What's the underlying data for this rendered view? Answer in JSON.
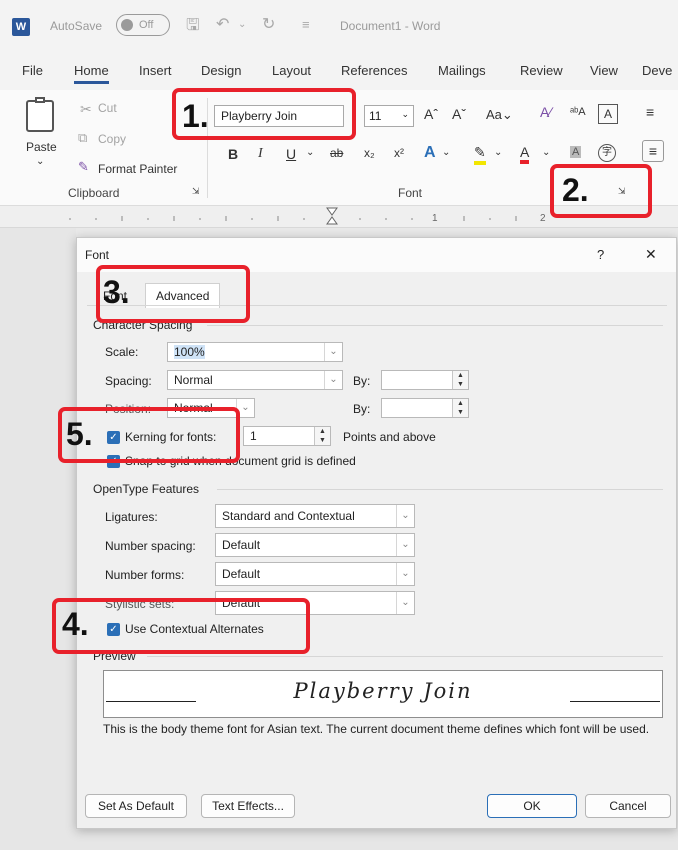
{
  "window": {
    "autosave_label": "AutoSave",
    "autosave_state": "Off",
    "doc_title": "Document1  -  Word"
  },
  "menu": [
    "File",
    "Home",
    "Insert",
    "Design",
    "Layout",
    "References",
    "Mailings",
    "Review",
    "View",
    "Deve"
  ],
  "ribbon": {
    "paste": "Paste",
    "cut": "Cut",
    "copy": "Copy",
    "format_painter": "Format Painter",
    "clipboard_group": "Clipboard",
    "font_name": "Playberry Join",
    "font_size": "11",
    "font_group": "Font"
  },
  "dialog": {
    "title": "Font",
    "help": "?",
    "close": "✕",
    "tabs": [
      "Font",
      "Advanced"
    ],
    "char_spacing_heading": "Character Spacing",
    "scale_label": "Scale:",
    "scale_value": "100%",
    "spacing_label": "Spacing:",
    "spacing_value": "Normal",
    "by1_label": "By:",
    "position_label": "Position:",
    "position_value": "Normal",
    "by2_label": "By:",
    "kerning_label": "Kerning for fonts:",
    "kerning_value": "1",
    "points_label": "Points and above",
    "snap_label": "Snap to grid when document grid is defined",
    "opentype_heading": "OpenType Features",
    "ligatures_label": "Ligatures:",
    "ligatures_value": "Standard and Contextual",
    "num_spacing_label": "Number spacing:",
    "num_spacing_value": "Default",
    "num_forms_label": "Number forms:",
    "num_forms_value": "Default",
    "stylistic_label": "Stylistic sets:",
    "stylistic_value": "Default",
    "contextual_label": "Use Contextual Alternates",
    "preview_heading": "Preview",
    "preview_text": "Playberry Join",
    "description": "This is the body theme font for Asian text. The current document theme defines which font will be used.",
    "btn_set_default": "Set As Default",
    "btn_text_effects": "Text Effects...",
    "btn_ok": "OK",
    "btn_cancel": "Cancel"
  },
  "callouts": [
    "1.",
    "2.",
    "3.",
    "4.",
    "5."
  ],
  "callout_color": "#e8212b",
  "accent_color": "#2b579a"
}
